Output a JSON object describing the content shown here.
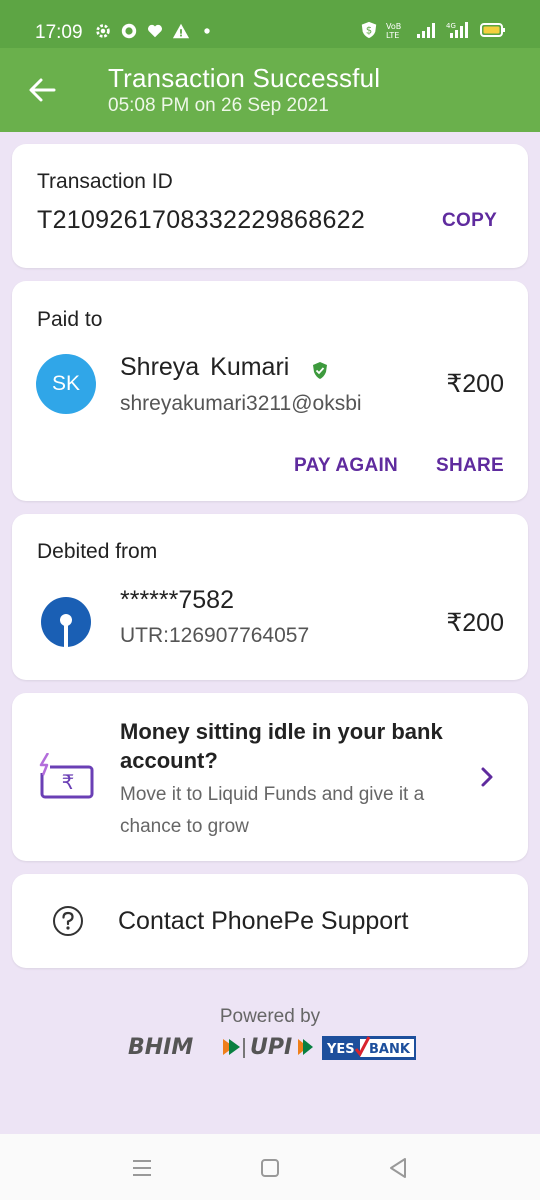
{
  "status_bar": {
    "time": "17:09",
    "left_icons": [
      "settings-icon",
      "record-icon",
      "heart-icon",
      "warning-icon",
      "dot-icon"
    ],
    "right_icons": [
      "shield-dollar-icon",
      "volte-icon",
      "signal-icon",
      "4g-signal-icon",
      "battery-icon"
    ]
  },
  "header": {
    "title": "Transaction Successful",
    "subtitle": "05:08 PM on 26 Sep 2021",
    "bg_color": "#6ab04c"
  },
  "transaction": {
    "label": "Transaction ID",
    "id": "T2109261708332229868622",
    "copy_label": "COPY"
  },
  "paid_to": {
    "label": "Paid to",
    "avatar_initials": "SK",
    "name": "Shreya  Kumari",
    "upi_id": "shreyakumari3211@oksbi",
    "amount": "₹200",
    "pay_again_label": "PAY AGAIN",
    "share_label": "SHARE"
  },
  "debited_from": {
    "label": "Debited from",
    "account": "******7582",
    "utr": "UTR:126907764057",
    "amount": "₹200"
  },
  "promo": {
    "title": "Money sitting idle in your bank account?",
    "body": "Move it to Liquid Funds and give it a chance to grow"
  },
  "support": {
    "label": "Contact PhonePe Support"
  },
  "footer": {
    "powered_by": "Powered by",
    "logo_bhim": "BHIM",
    "logo_upi": "UPI",
    "logo_yes": "YES",
    "logo_bank": "BANK"
  },
  "colors": {
    "accent": "#5f2b9e",
    "page_bg": "#ede4f5",
    "avatar": "#30a6e8",
    "bank_logo": "#1a5fb4",
    "verified": "#3d9a3d"
  }
}
